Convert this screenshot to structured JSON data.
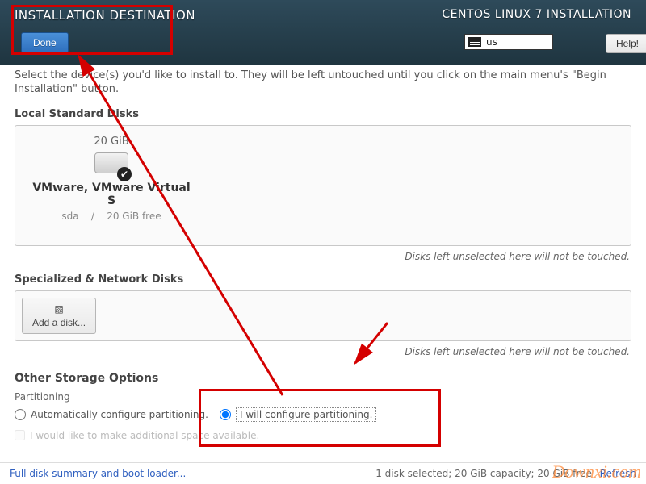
{
  "header": {
    "page_title": "INSTALLATION DESTINATION",
    "install_title": "CENTOS LINUX 7 INSTALLATION",
    "done_label": "Done",
    "keyboard_layout": "us",
    "help_label": "Help!"
  },
  "intro": "Select the device(s) you'd like to install to.  They will be left untouched until you click on the main menu's \"Begin Installation\" button.",
  "local_disks": {
    "heading": "Local Standard Disks",
    "disk": {
      "size": "20 GiB",
      "name": "VMware, VMware Virtual S",
      "dev": "sda",
      "sep": "/",
      "free": "20 GiB free"
    },
    "unselected_note": "Disks left unselected here will not be touched."
  },
  "network_disks": {
    "heading": "Specialized & Network Disks",
    "add_label": "Add a disk...",
    "unselected_note": "Disks left unselected here will not be touched."
  },
  "storage": {
    "heading": "Other Storage Options",
    "partitioning_label": "Partitioning",
    "auto_label": "Automatically configure partitioning.",
    "manual_label": "I will configure partitioning.",
    "additional_label": "I would like to make additional space available."
  },
  "footer": {
    "link": "Full disk summary and boot loader...",
    "status": "1 disk selected; 20 GiB capacity; 20 GiB free",
    "refresh": "Refresh"
  },
  "watermark": "Downxi.com"
}
